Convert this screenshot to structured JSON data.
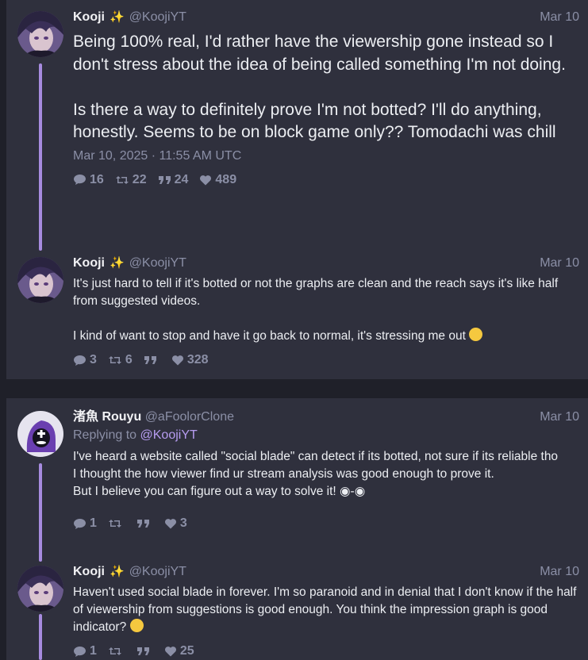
{
  "posts": [
    {
      "name": "Kooji",
      "badge": "✨",
      "handle": "@KoojiYT",
      "date": "Mar 10",
      "text": "Being 100% real, I'd rather have the viewership gone instead so I don't stress about the idea of being called something I'm not doing.\n\nIs there a way to definitely prove I'm not botted? I'll do anything, honestly. Seems to be on block game only?? Tomodachi was chill",
      "timestamp": "Mar 10, 2025 · 11:55 AM UTC",
      "stats": {
        "replies": "16",
        "retweets": "22",
        "quotes": "24",
        "likes": "489"
      }
    },
    {
      "name": "Kooji",
      "badge": "✨",
      "handle": "@KoojiYT",
      "date": "Mar 10",
      "text": "It's just hard to tell if it's botted or not the graphs are clean and the reach says it's like half from suggested videos.\n\nI kind of want to stop and have it go back to normal, it's stressing me out",
      "stats": {
        "replies": "3",
        "retweets": "6",
        "quotes": "",
        "likes": "328"
      }
    },
    {
      "name": "渚魚 Rouyu",
      "handle": "@aFoolorClone",
      "date": "Mar 10",
      "replying_label": "Replying to",
      "replying_to": "@KoojiYT",
      "text": "I've heard a website called \"social blade\" can detect if its botted, not sure if its reliable tho\nI thought the how viewer find ur stream analysis was good enough to prove it.\nBut I believe you can figure out a way to solve it! ◉-◉",
      "stats": {
        "replies": "1",
        "retweets": "",
        "quotes": "",
        "likes": "3"
      }
    },
    {
      "name": "Kooji",
      "badge": "✨",
      "handle": "@KoojiYT",
      "date": "Mar 10",
      "text": "Haven't used social blade in forever. I'm so paranoid and in denial that I don't know if the half of viewership from suggestions is good enough. You think the impression graph is good indicator?",
      "stats": {
        "replies": "1",
        "retweets": "",
        "quotes": "",
        "likes": "25"
      }
    }
  ],
  "colors": {
    "accent": "#a78bdf",
    "card": "#2f303d",
    "background": "#1f2029",
    "muted": "#8b8fa6"
  }
}
